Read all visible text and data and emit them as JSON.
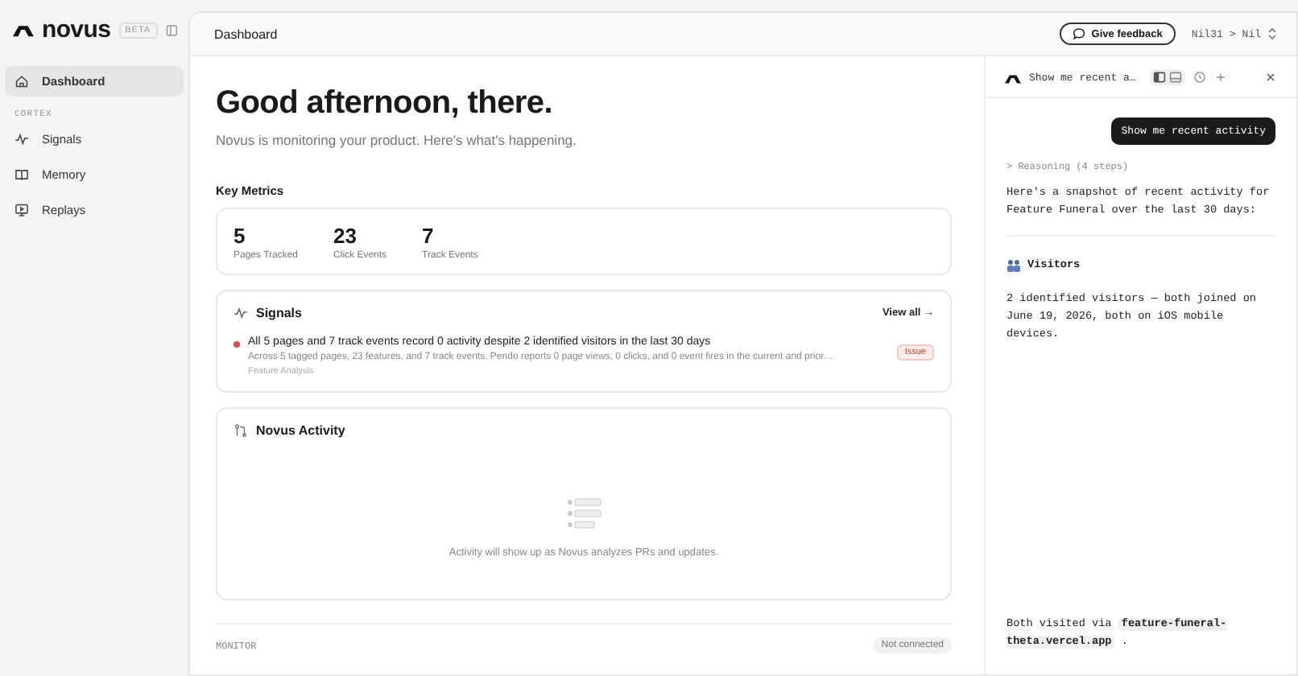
{
  "brand": {
    "name": "novus",
    "badge": "BETA"
  },
  "sidebar": {
    "items": [
      {
        "label": "Dashboard",
        "selected": true
      }
    ],
    "section": "CORTEX",
    "section_items": [
      {
        "label": "Signals",
        "selected": false
      },
      {
        "label": "Memory",
        "selected": false
      },
      {
        "label": "Replays",
        "selected": false
      }
    ]
  },
  "header": {
    "title": "Dashboard",
    "feedback": "Give feedback",
    "crumb_org": "Nil31",
    "crumb_sep": ">",
    "crumb_project": "Nil"
  },
  "greeting": {
    "title": "Good afternoon, there.",
    "subtitle": "Novus is monitoring your product. Here's what's happening."
  },
  "key_metrics": {
    "title": "Key Metrics",
    "metrics": [
      {
        "value": "5",
        "label": "Pages Tracked"
      },
      {
        "value": "23",
        "label": "Click Events"
      },
      {
        "value": "7",
        "label": "Track Events"
      }
    ]
  },
  "signals": {
    "title": "Signals",
    "view_all": "View all →",
    "items": [
      {
        "title": "All 5 pages and 7 track events record 0 activity despite 2 identified visitors in the last 30 days",
        "description": "Across 5 tagged pages, 23 features, and 7 track events, Pendo reports 0 page views, 0 clicks, and 0 event fires in the current and prior…",
        "category": "Feature Analysis",
        "tag": "Issue",
        "color": "#e5484d"
      }
    ]
  },
  "activity": {
    "title": "Novus Activity",
    "empty": "Activity will show up as Novus analyzes PRs and updates."
  },
  "monitor": {
    "label": "MONITOR",
    "status": "Not connected"
  },
  "chat": {
    "title": "Show me recent a…",
    "user_message": "Show me recent activity",
    "reasoning": "> Reasoning (4 steps)",
    "intro": "Here's a snapshot of recent activity for Feature Funeral over the last 30 days:",
    "section": "Visitors",
    "body": "2 identified visitors — both joined on June 19, 2026, both on iOS mobile devices.",
    "footer_text": "Both visited via",
    "footer_code": "feature-funeral-theta.vercel.app",
    "footer_end": "."
  }
}
